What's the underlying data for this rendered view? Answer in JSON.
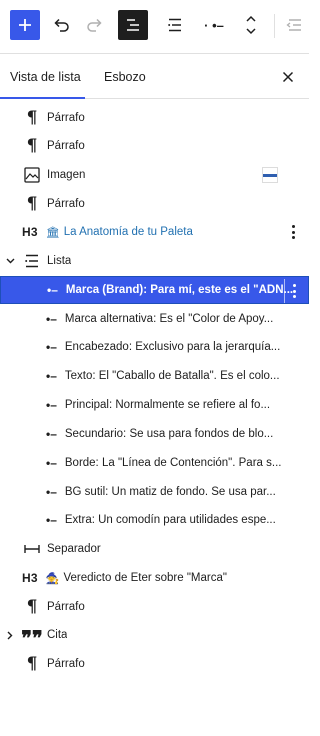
{
  "toolbar": {
    "add_icon": "plus-icon",
    "undo_icon": "undo-icon",
    "redo_icon": "redo-icon",
    "list_view_icon": "list-view-icon",
    "block_icon": "list-block-icon",
    "indent_dots": "· •–",
    "move_icon": "chevron-up-down-icon",
    "outdent_icon": "outdent-icon"
  },
  "tabs": {
    "list_view": "Vista de lista",
    "outline": "Esbozo"
  },
  "colors": {
    "accent": "#3858e9",
    "link": "#2271b1"
  },
  "blocks": [
    {
      "type": "paragraph",
      "label": "Párrafo"
    },
    {
      "type": "paragraph",
      "label": "Párrafo"
    },
    {
      "type": "image",
      "label": "Imagen"
    },
    {
      "type": "paragraph",
      "label": "Párrafo"
    },
    {
      "type": "heading",
      "badge": "H3",
      "emoji": "🏛",
      "label": "La Anatomía de tu Paleta"
    },
    {
      "type": "list",
      "label": "Lista"
    },
    {
      "type": "list-item",
      "label": "Marca (Brand): Para mí, este es el \"ADN...",
      "selected": true
    },
    {
      "type": "list-item",
      "label": "Marca alternativa: Es el \"Color de Apoy..."
    },
    {
      "type": "list-item",
      "label": "Encabezado: Exclusivo para la jerarquía..."
    },
    {
      "type": "list-item",
      "label": "Texto: El \"Caballo de Batalla\". Es el colo..."
    },
    {
      "type": "list-item",
      "label": "Principal: Normalmente se refiere al fo..."
    },
    {
      "type": "list-item",
      "label": "Secundario: Se usa para fondos de blo..."
    },
    {
      "type": "list-item",
      "label": "Borde: La \"Línea de Contención\". Para s..."
    },
    {
      "type": "list-item",
      "label": "BG sutil: Un matiz de fondo. Se usa par..."
    },
    {
      "type": "list-item",
      "label": "Extra: Un comodín para utilidades espe..."
    },
    {
      "type": "separator",
      "label": "Separador"
    },
    {
      "type": "heading",
      "badge": "H3",
      "emoji": "🧙",
      "label": "Veredicto de Eter sobre \"Marca\""
    },
    {
      "type": "paragraph",
      "label": "Párrafo"
    },
    {
      "type": "quote",
      "label": "Cita"
    },
    {
      "type": "paragraph",
      "label": "Párrafo"
    }
  ]
}
